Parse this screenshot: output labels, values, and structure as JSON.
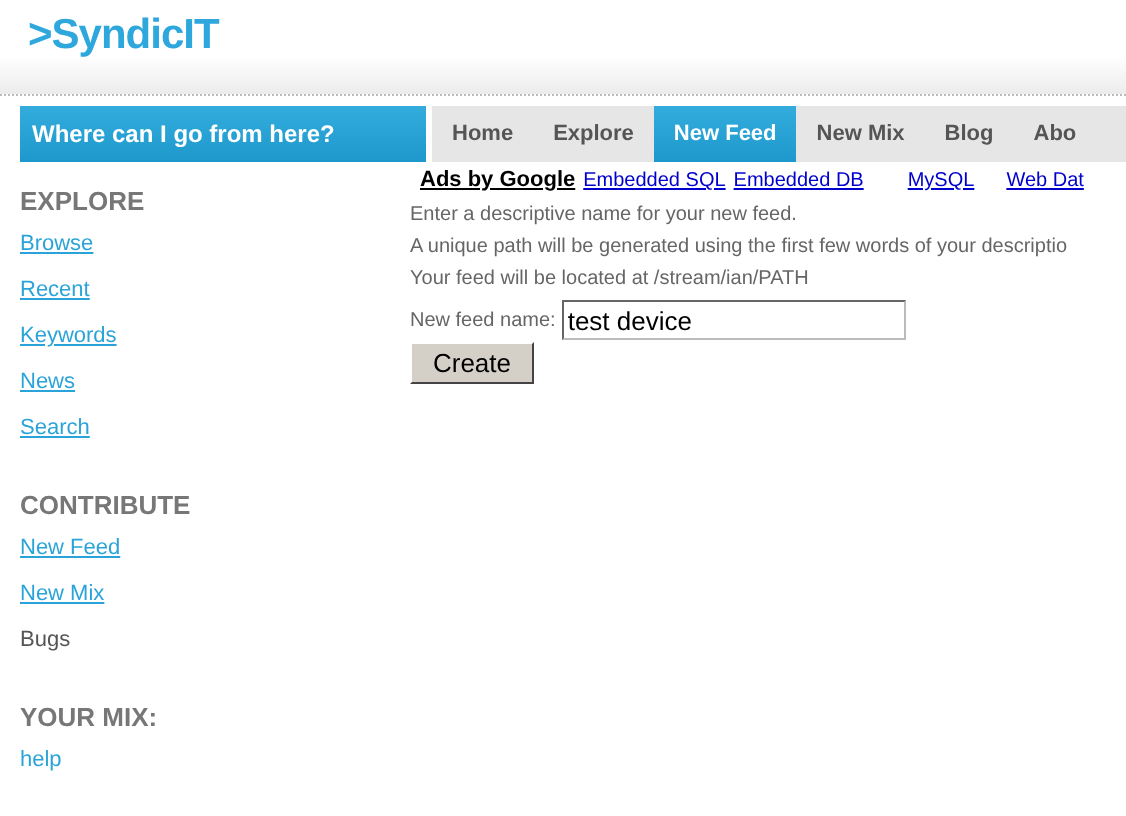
{
  "logo": ">SyndicIT",
  "nav": {
    "prompt": "Where can I go from here?",
    "tabs": [
      {
        "label": "Home",
        "selected": false
      },
      {
        "label": "Explore",
        "selected": false
      },
      {
        "label": "New Feed",
        "selected": true
      },
      {
        "label": "New Mix",
        "selected": false
      },
      {
        "label": "Blog",
        "selected": false
      },
      {
        "label": "Abo",
        "selected": false
      }
    ]
  },
  "sidebar": [
    {
      "heading": "EXPLORE",
      "items": [
        {
          "label": "Browse",
          "kind": "link"
        },
        {
          "label": "Recent",
          "kind": "link"
        },
        {
          "label": "Keywords",
          "kind": "link"
        },
        {
          "label": "News",
          "kind": "link"
        },
        {
          "label": "Search",
          "kind": "link"
        }
      ]
    },
    {
      "heading": "CONTRIBUTE",
      "items": [
        {
          "label": "New Feed",
          "kind": "link"
        },
        {
          "label": "New Mix",
          "kind": "link"
        },
        {
          "label": "Bugs",
          "kind": "text"
        }
      ]
    },
    {
      "heading": "YOUR MIX:",
      "items": [
        {
          "label": "help",
          "kind": "plain-link"
        }
      ]
    }
  ],
  "ads": {
    "title": "Ads by Google",
    "links": [
      "Embedded SQL",
      "Embedded DB",
      "MySQL",
      "Web Dat"
    ]
  },
  "form": {
    "lines": [
      "Enter a descriptive name for your new feed.",
      "A unique path will be generated using the first few words of your descriptio",
      "Your feed will be located at /stream/ian/PATH"
    ],
    "field_label": "New feed name:",
    "field_value": "test device",
    "button": "Create"
  }
}
